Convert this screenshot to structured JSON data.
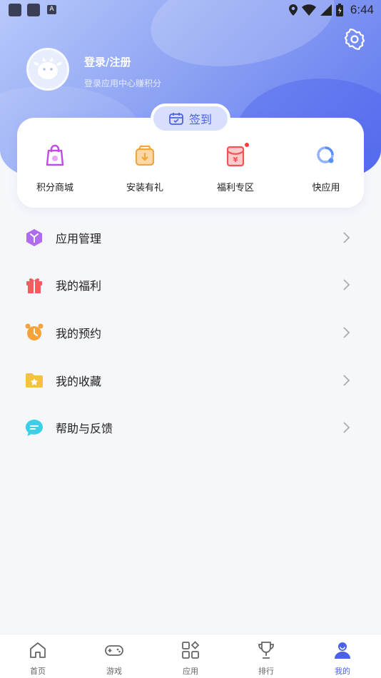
{
  "status_bar": {
    "time": "6:44",
    "a_label": "A"
  },
  "profile": {
    "title": "登录/注册",
    "subtitle": "登录应用中心赚积分"
  },
  "checkin": {
    "label": "签到"
  },
  "quick_actions": [
    {
      "label": "积分商城",
      "icon": "shopping-bag-icon",
      "color": "#c04be6"
    },
    {
      "label": "安装有礼",
      "icon": "gift-box-download-icon",
      "color": "#f2a73b"
    },
    {
      "label": "福利专区",
      "icon": "red-packet-icon",
      "color": "#f05454",
      "badge": true
    },
    {
      "label": "快应用",
      "icon": "quick-app-icon",
      "color": "#5a8ff5"
    }
  ],
  "menu": [
    {
      "label": "应用管理",
      "icon": "app-cube-icon",
      "color": "#b06bf0"
    },
    {
      "label": "我的福利",
      "icon": "gift-icon",
      "color": "#f25c5c"
    },
    {
      "label": "我的预约",
      "icon": "alarm-clock-icon",
      "color": "#f5a33b"
    },
    {
      "label": "我的收藏",
      "icon": "folder-star-icon",
      "color": "#f5c33b"
    },
    {
      "label": "帮助与反馈",
      "icon": "chat-bubble-icon",
      "color": "#3ccfe6"
    }
  ],
  "tabs": [
    {
      "label": "首页",
      "icon": "home-icon",
      "active": false
    },
    {
      "label": "游戏",
      "icon": "gamepad-icon",
      "active": false
    },
    {
      "label": "应用",
      "icon": "apps-grid-icon",
      "active": false
    },
    {
      "label": "排行",
      "icon": "trophy-icon",
      "active": false
    },
    {
      "label": "我的",
      "icon": "profile-icon",
      "active": true
    }
  ],
  "colors": {
    "accent": "#4b62e6",
    "header_start": "#b8c9fb",
    "header_end": "#5c73f0"
  }
}
